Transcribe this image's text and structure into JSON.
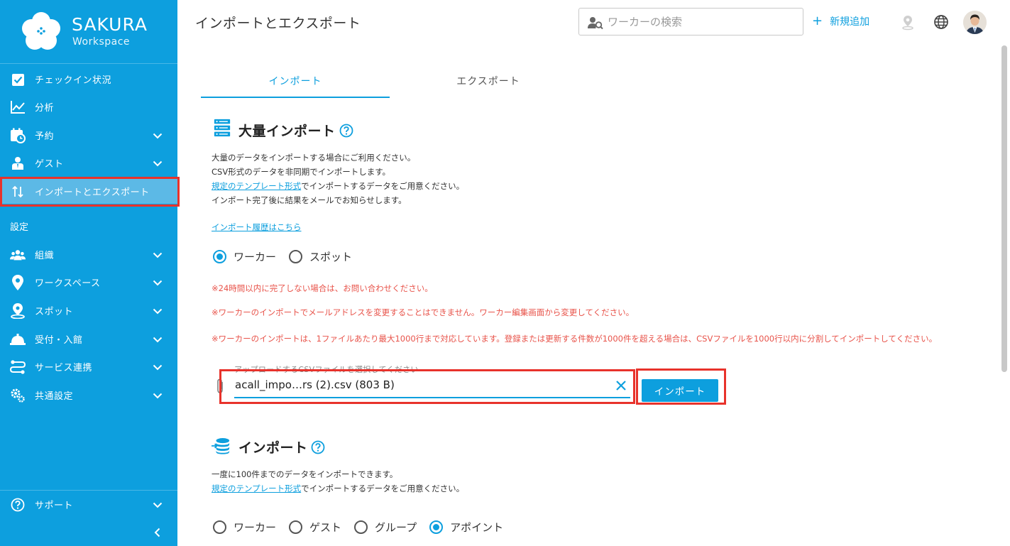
{
  "brand": {
    "name": "SAKURA",
    "sub": "Workspace"
  },
  "sidebar": {
    "items": [
      {
        "label": "チェックイン状況"
      },
      {
        "label": "分析"
      },
      {
        "label": "予約"
      },
      {
        "label": "ゲスト"
      },
      {
        "label": "インポートとエクスポート"
      }
    ],
    "settings_label": "設定",
    "settings_items": [
      {
        "label": "組織"
      },
      {
        "label": "ワークスペース"
      },
      {
        "label": "スポット"
      },
      {
        "label": "受付・入館"
      },
      {
        "label": "サービス連携"
      },
      {
        "label": "共通設定"
      }
    ],
    "support_label": "サポート"
  },
  "header": {
    "title": "インポートとエクスポート",
    "search_placeholder": "ワーカーの検索",
    "add_new": "新規追加"
  },
  "tabs": {
    "import": "インポート",
    "export": "エクスポート"
  },
  "bulk": {
    "title": "大量インポート",
    "desc1": "大量のデータをインポートする場合にご利用ください。",
    "desc2": "CSV形式のデータを非同期でインポートします。",
    "template_link": "規定のテンプレート形式",
    "desc3_rest": "でインポートするデータをご用意ください。",
    "desc4": "インポート完了後に結果をメールでお知らせします。",
    "history_link": "インポート履歴はこちら",
    "radio_worker": "ワーカー",
    "radio_spot": "スポット",
    "warn1": "※24時間以内に完了しない場合は、お問い合わせください。",
    "warn2": "※ワーカーのインポートでメールアドレスを変更することはできません。ワーカー編集画面から変更してください。",
    "warn3": "※ワーカーのインポートは、1ファイルあたり最大1000行まで対応しています。登録または更新する件数が1000件を超える場合は、CSVファイルを1000行以内に分割してインポートしてください。",
    "file_label": "アップロードするCSVファイルを選択してください",
    "file_value": "acall_impo…rs (2).csv (803 B)",
    "import_button": "インポート"
  },
  "simple": {
    "title": "インポート",
    "desc1": "一度に100件までのデータをインポートできます。",
    "template_link": "規定のテンプレート形式",
    "desc2_rest": "でインポートするデータをご用意ください。",
    "radio_worker": "ワーカー",
    "radio_guest": "ゲスト",
    "radio_group": "グループ",
    "radio_appoint": "アポイント"
  },
  "colors": {
    "accent": "#0d9fde",
    "warning": "#e8534a",
    "highlight": "#e8322b"
  }
}
